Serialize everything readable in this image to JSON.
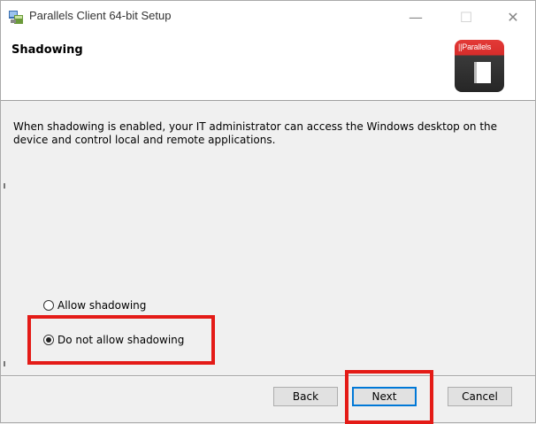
{
  "window": {
    "title": "Parallels Client 64-bit Setup",
    "controls": {
      "minimize": "—",
      "maximize": "☐",
      "close": "✕"
    }
  },
  "header": {
    "title": "Shadowing",
    "logo_text": "||Parallels"
  },
  "body": {
    "description": "When shadowing is enabled, your IT administrator can access the Windows desktop on the device and control local and remote applications."
  },
  "options": {
    "allow": {
      "label": "Allow shadowing",
      "selected": false
    },
    "deny": {
      "label": "Do not allow shadowing",
      "selected": true
    }
  },
  "buttons": {
    "back": "Back",
    "next": "Next",
    "cancel": "Cancel"
  },
  "colors": {
    "highlight": "#e41b17",
    "focus": "#0078d7",
    "logo_red": "#d62c2a",
    "logo_dark": "#262626"
  },
  "icons": [
    "installer-app-icon",
    "parallels-logo-icon",
    "radio-icon"
  ]
}
